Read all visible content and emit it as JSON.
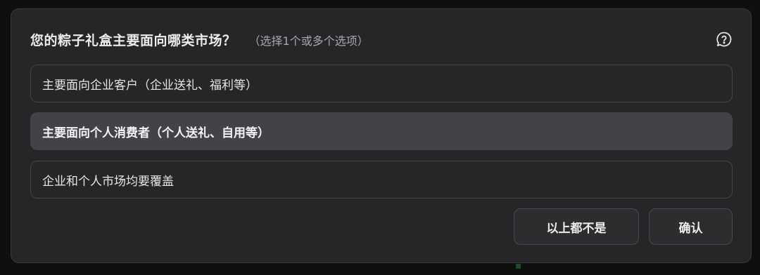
{
  "question": {
    "title": "您的粽子礼盒主要面向哪类市场？",
    "hint": "（选择1个或多个选项）",
    "help_icon": "question-bubble-icon"
  },
  "options": [
    {
      "label": "主要面向企业客户（企业送礼、福利等）",
      "selected": false
    },
    {
      "label": "主要面向个人消费者（个人送礼、自用等）",
      "selected": true
    },
    {
      "label": "企业和个人市场均要覆盖",
      "selected": false
    }
  ],
  "actions": {
    "none_label": "以上都不是",
    "confirm_label": "确认"
  },
  "colors": {
    "panel": "#262628",
    "selected": "#434347",
    "border": "#454548"
  }
}
